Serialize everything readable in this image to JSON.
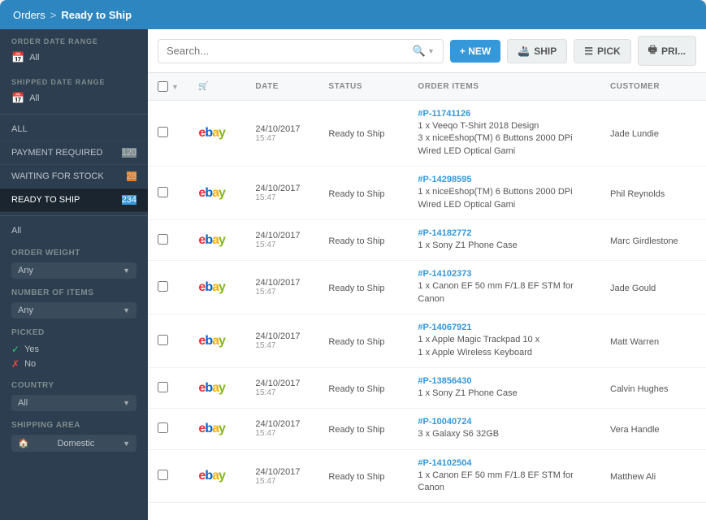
{
  "nav": {
    "parent": "Orders",
    "separator": ">",
    "current": "Ready to Ship"
  },
  "toolbar": {
    "search_placeholder": "Search...",
    "btn_new": "+ NEW",
    "btn_ship": "SHIP",
    "btn_pick": "PICK",
    "btn_print": "PRI..."
  },
  "sidebar": {
    "order_date_range_label": "ORDER DATE RANGE",
    "order_date_range_value": "All",
    "shipped_date_range_label": "SHIPPED DATE RANGE",
    "shipped_date_range_value": "All",
    "all_label": "ALL",
    "payment_required_label": "PAYMENT REQUIRED",
    "payment_required_badge": "120",
    "waiting_for_stock_label": "WAITING FOR STOCK",
    "waiting_for_stock_badge": "28",
    "ready_to_ship_label": "READY TO SHIP",
    "ready_to_ship_badge": "234",
    "all_link": "All",
    "filters": {
      "order_weight": {
        "label": "Order Weight",
        "value": "Any"
      },
      "number_of_items": {
        "label": "Number of Items",
        "value": "Any"
      },
      "picked": {
        "label": "Picked",
        "yes_label": "Yes",
        "no_label": "No"
      },
      "country": {
        "label": "Country",
        "value": "All"
      },
      "shipping_area": {
        "label": "Shipping Area",
        "value": "Domestic"
      }
    }
  },
  "table": {
    "columns": [
      "",
      "",
      "DATE",
      "STATUS",
      "ORDER ITEMS",
      "CUSTOMER"
    ],
    "rows": [
      {
        "order_id": "#P-11741126",
        "store": "ebay",
        "date": "24/10/2017",
        "time": "15:47",
        "status": "Ready to Ship",
        "item_line1": "1 x Veeqo T-Shirt 2018 Design",
        "item_line2": "3 x niceEshop(TM) 6 Buttons 2000 DPi Wired LED Optical Gami",
        "customer": "Jade Lundie"
      },
      {
        "order_id": "#P-14298595",
        "store": "ebay",
        "date": "24/10/2017",
        "time": "15:47",
        "status": "Ready to Ship",
        "item_line1": "1 x niceEshop(TM) 6 Buttons 2000 DPi Wired LED Optical Gami",
        "item_line2": "",
        "customer": "Phil Reynolds"
      },
      {
        "order_id": "#P-14182772",
        "store": "ebay",
        "date": "24/10/2017",
        "time": "15:47",
        "status": "Ready to Ship",
        "item_line1": "1 x Sony Z1 Phone Case",
        "item_line2": "",
        "customer": "Marc Girdlestone"
      },
      {
        "order_id": "#P-14102373",
        "store": "ebay",
        "date": "24/10/2017",
        "time": "15:47",
        "status": "Ready to Ship",
        "item_line1": "1 x Canon EF 50 mm F/1.8 EF STM for Canon",
        "item_line2": "",
        "customer": "Jade Gould"
      },
      {
        "order_id": "#P-14067921",
        "store": "ebay",
        "date": "24/10/2017",
        "time": "15:47",
        "status": "Ready to Ship",
        "item_line1": "1 x Apple Magic Trackpad 10 x",
        "item_line2": "1 x Apple Wireless Keyboard",
        "customer": "Matt Warren"
      },
      {
        "order_id": "#P-13856430",
        "store": "ebay",
        "date": "24/10/2017",
        "time": "15:47",
        "status": "Ready to Ship",
        "item_line1": "1 x Sony Z1 Phone Case",
        "item_line2": "",
        "customer": "Calvin Hughes"
      },
      {
        "order_id": "#P-10040724",
        "store": "ebay",
        "date": "24/10/2017",
        "time": "15:47",
        "status": "Ready to Ship",
        "item_line1": "3 x Galaxy S6 32GB",
        "item_line2": "",
        "customer": "Vera Handle"
      },
      {
        "order_id": "#P-14102504",
        "store": "ebay",
        "date": "24/10/2017",
        "time": "15:47",
        "status": "Ready to Ship",
        "item_line1": "1 x Canon EF 50 mm F/1.8 EF STM for Canon",
        "item_line2": "",
        "customer": "Matthew Ali"
      }
    ]
  }
}
